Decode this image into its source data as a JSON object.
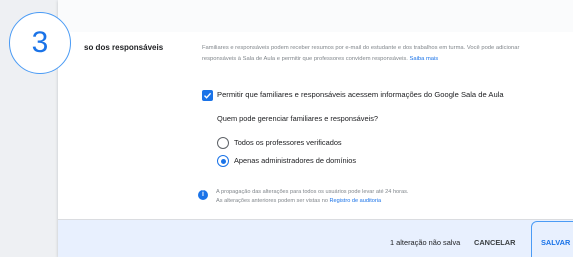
{
  "section": {
    "title": "Acesso dos responsáveis",
    "title_visible": "so dos responsáveis",
    "description": "Familiares e responsáveis podem receber resumos por e-mail do estudante e dos trabalhos em turma. Você pode adicionar responsáveis à Sala de Aula e permitir que professores convidem responsáveis.",
    "learn_more": "Saiba mais"
  },
  "setting": {
    "checkbox_label": "Permitir que familiares e responsáveis acessem informações do Google Sala de Aula",
    "checked": true,
    "question": "Quem pode gerenciar familiares e responsáveis?",
    "options": [
      {
        "label": "Todos os professores verificados",
        "selected": false
      },
      {
        "label": "Apenas administradores de domínios",
        "selected": true
      }
    ]
  },
  "info": {
    "line1": "A propagação das alterações para todos os usuários pode levar até 24 horas.",
    "line2_prefix": "As alterações anteriores podem ser vistas no",
    "audit_link": "Registro de auditoria"
  },
  "footer": {
    "unsaved": "1 alteração não salva",
    "cancel": "CANCELAR",
    "save": "SALVAR"
  },
  "step_badge": "3",
  "colors": {
    "accent": "#1a73e8",
    "footer_bg": "#e8f0fe",
    "highlight_outline": "#4a9bf5"
  },
  "icons": {
    "checkbox": "check-icon",
    "info": "info-icon"
  }
}
